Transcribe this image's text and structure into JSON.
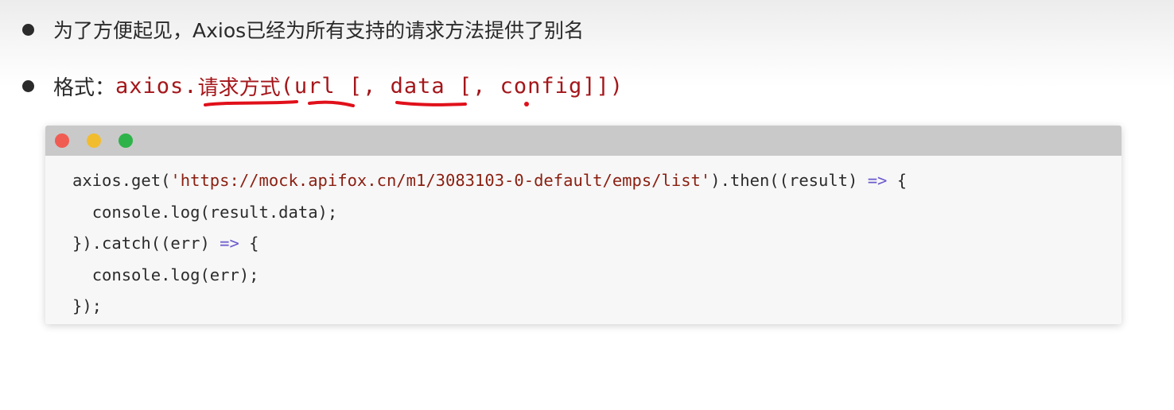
{
  "bullets": [
    {
      "text": "为了方便起见，Axios已经为所有支持的请求方法提供了别名"
    }
  ],
  "format": {
    "label": "格式：",
    "code_prefix": "axios.",
    "method_placeholder": "请求方式",
    "code_rest": "(url [, data [, config]])"
  },
  "code_window": {
    "lines": [
      {
        "indent": "",
        "parts": [
          {
            "text": "axios.get(",
            "kind": "plain"
          },
          {
            "text": "'https://mock.apifox.cn/m1/3083103-0-default/emps/list'",
            "kind": "string"
          },
          {
            "text": ").then((result) ",
            "kind": "plain"
          },
          {
            "text": "=>",
            "kind": "arrow"
          },
          {
            "text": " {",
            "kind": "plain"
          }
        ]
      },
      {
        "indent": "  ",
        "parts": [
          {
            "text": "console.log(result.data);",
            "kind": "plain"
          }
        ]
      },
      {
        "indent": "",
        "parts": [
          {
            "text": "}).catch((err) ",
            "kind": "plain"
          },
          {
            "text": "=>",
            "kind": "arrow"
          },
          {
            "text": " {",
            "kind": "plain"
          }
        ]
      },
      {
        "indent": "  ",
        "parts": [
          {
            "text": "console.log(err);",
            "kind": "plain"
          }
        ]
      },
      {
        "indent": "",
        "parts": [
          {
            "text": "});",
            "kind": "plain"
          }
        ]
      }
    ]
  },
  "colors": {
    "accent_red": "#a4161a",
    "annotation_red": "#e0101a",
    "traffic_red": "#f05c52",
    "traffic_yellow": "#f2bc2f",
    "traffic_green": "#2db34a"
  }
}
